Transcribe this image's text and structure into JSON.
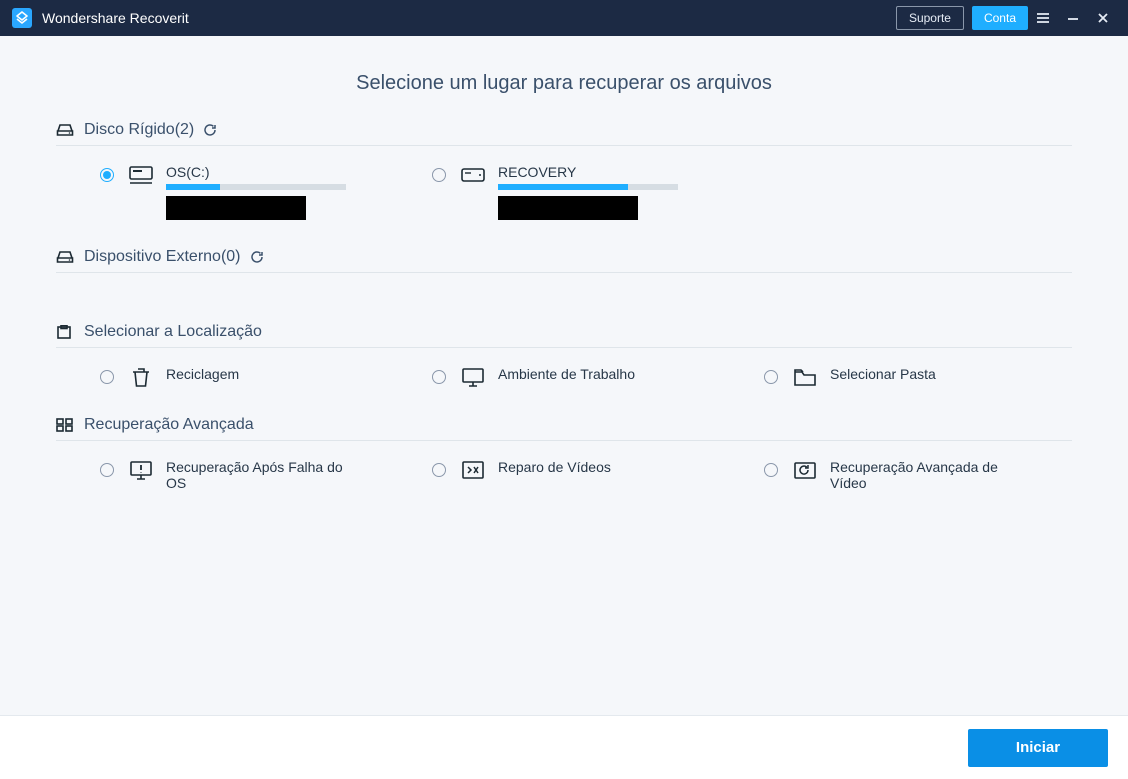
{
  "titlebar": {
    "app_name": "Wondershare Recoverit",
    "support_label": "Suporte",
    "account_label": "Conta"
  },
  "page": {
    "title": "Selecione um lugar para recuperar os arquivos"
  },
  "sections": {
    "hdd": {
      "label": "Disco Rígido(2)"
    },
    "external": {
      "label": "Dispositivo Externo(0)"
    },
    "location": {
      "label": "Selecionar a Localização"
    },
    "advanced": {
      "label": "Recuperação Avançada"
    }
  },
  "drives": {
    "os": {
      "title": "OS(C:)",
      "fill_pct": 30
    },
    "recovery": {
      "title": "RECOVERY",
      "fill_pct": 72
    }
  },
  "locations": {
    "recycle": {
      "title": "Reciclagem"
    },
    "desktop": {
      "title": "Ambiente de Trabalho"
    },
    "folder": {
      "title": "Selecionar Pasta"
    }
  },
  "advanced": {
    "oscrash": {
      "title": "Recuperação Após Falha do OS"
    },
    "video": {
      "title": "Reparo de Vídeos"
    },
    "advvideo": {
      "title": "Recuperação Avançada de Vídeo"
    }
  },
  "footer": {
    "start_label": "Iniciar"
  },
  "colors": {
    "accent": "#1faeff",
    "titlebar": "#1c2a44"
  }
}
